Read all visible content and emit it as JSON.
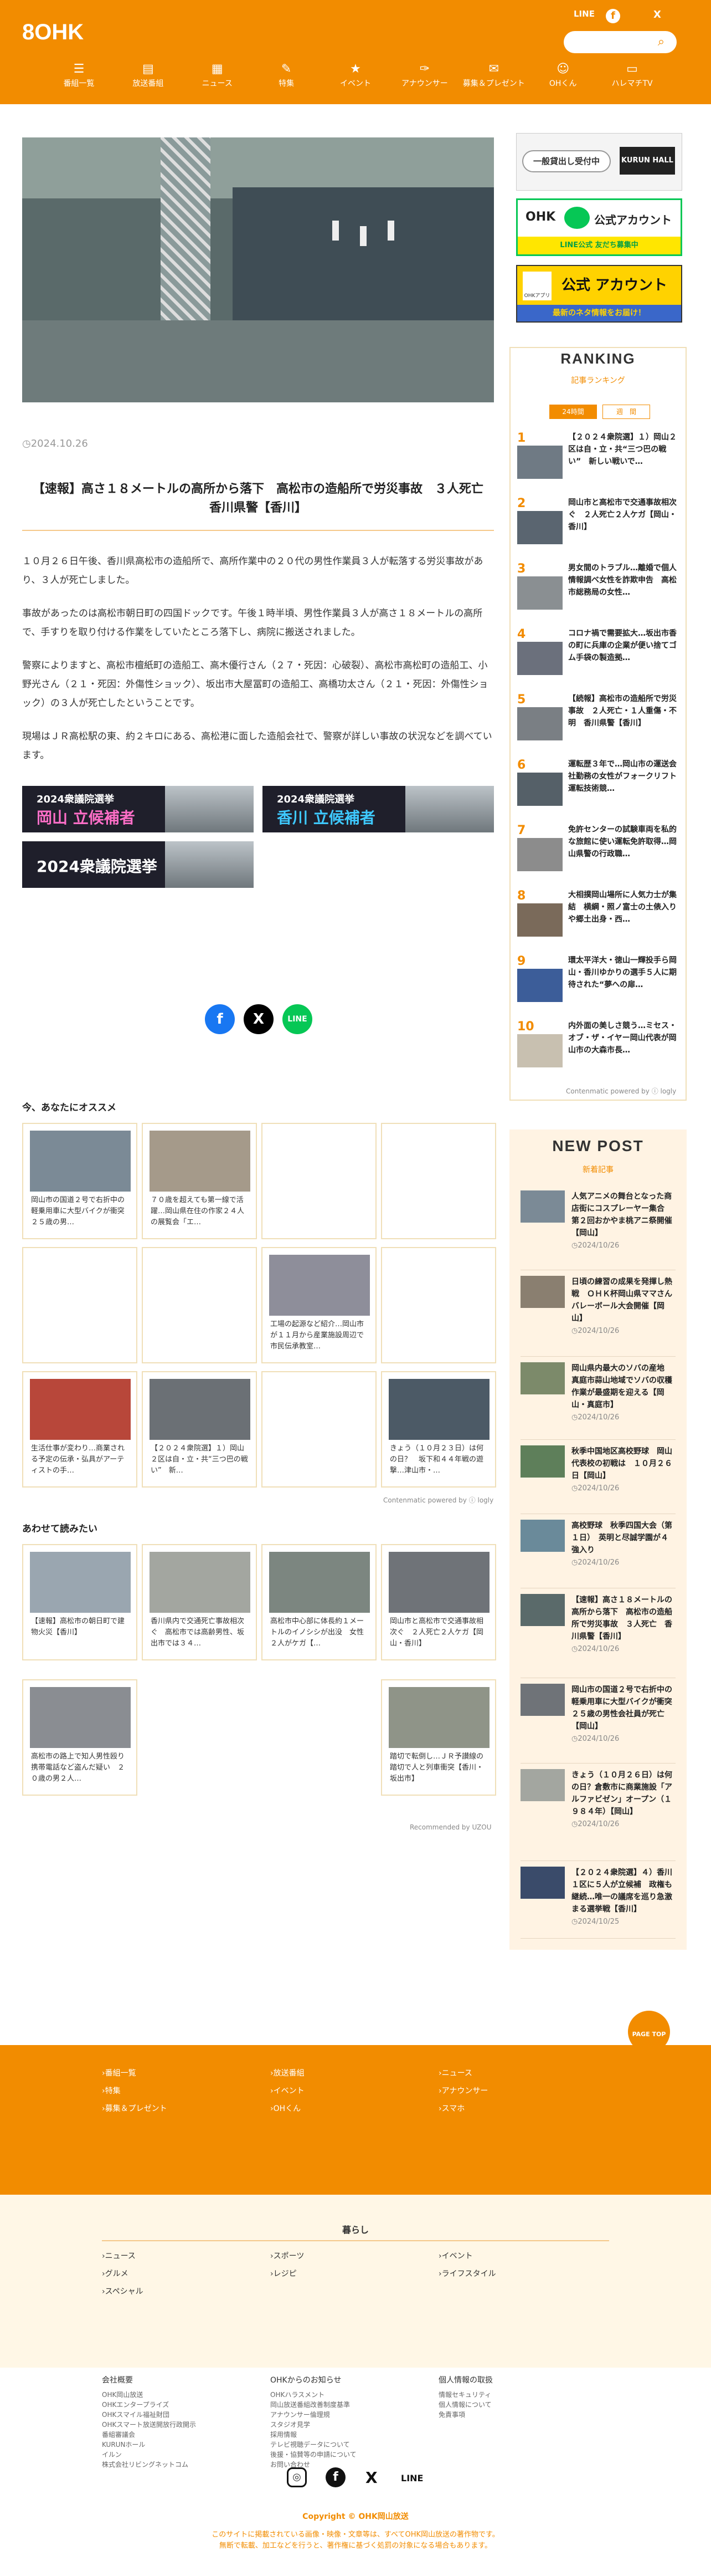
{
  "header": {
    "logo_num": "8",
    "logo_text": "OHK",
    "sns": [
      "LINE",
      "f",
      "X"
    ],
    "search_placeholder": "",
    "nav": [
      {
        "icon": "☰",
        "label": "番組一覧"
      },
      {
        "icon": "▤",
        "label": "放送番組"
      },
      {
        "icon": "▦",
        "label": "ニュース"
      },
      {
        "icon": "✎",
        "label": "特集"
      },
      {
        "icon": "★",
        "label": "イベント"
      },
      {
        "icon": "✑",
        "label": "アナウンサー"
      },
      {
        "icon": "✉",
        "label": "募集＆プレゼント"
      },
      {
        "icon": "☺",
        "label": "OHくん"
      },
      {
        "icon": "▭",
        "label": "ハレマチTV"
      }
    ]
  },
  "article": {
    "date": "2024.10.26",
    "title": "【速報】高さ１８メートルの高所から落下　高松市の造船所で労災事故　３人死亡　香川県警【香川】",
    "paragraphs": [
      "１０月２６日午後、香川県高松市の造船所で、高所作業中の２０代の男性作業員３人が転落する労災事故があり、３人が死亡しました。",
      "事故があったのは高松市朝日町の四国ドックです。午後１時半頃、男性作業員３人が高さ１８メートルの高所で、手すりを取り付ける作業をしていたところ落下し、病院に搬送されました。",
      "警察によりますと、高松市檀紙町の造船工、高木優行さん（２７・死因：心破裂）、高松市高松町の造船工、小野光さん（２１・死因：外傷性ショック）、坂出市大屋冨町の造船工、高橋功太さん（２１・死因：外傷性ショック）の３人が死亡したということです。",
      "現場はＪＲ高松駅の東、約２キロにある、高松港に面した造船会社で、警察が詳しい事故の状況などを調べています。"
    ],
    "banners": [
      {
        "year": "2024衆議院選挙",
        "name": "岡山 立候補者"
      },
      {
        "year": "2024衆議院選挙",
        "name": "香川 立候補者"
      },
      {
        "year": "",
        "name": "2024衆議院選挙"
      }
    ],
    "share": [
      "f",
      "X",
      "LINE"
    ]
  },
  "recommend": {
    "title": "今、あなたにオススメ",
    "cards": [
      "岡山市の国道２号で右折中の軽乗用車に大型バイクが衝突　２５歳の男…",
      "７０歳を超えても第一線で活躍…岡山県在住の作家２４人の展覧会「エ…",
      "",
      "",
      "",
      "",
      "工場の起源など紹介…岡山市が１１月から産業施設周辺で市民伝承教室…",
      "",
      "生活仕事が変わり…商業される予定の伝承・弘具がアーティストの手…",
      "【２０２４衆院選】１）岡山２区は自・立・共“三つ巴の戦い”　新…",
      "",
      "きょう（１０月２３日）は何の日？　坂下和４４年戦の遊撃…津山市・…"
    ],
    "powered": "Contenmatic powered by ⓘ logly"
  },
  "related": {
    "title": "あわせて読みたい",
    "cards": [
      "【速報】高松市の朝日町で建物火災【香川】",
      "香川県内で交通死亡事故相次ぐ　高松市では高齢男性、坂出市では３４…",
      "高松市中心部に体長約１メートルのイノシシが出没　女性２人がケガ【…",
      "岡山市と高松市で交通事故相次ぐ　２人死亡２人ケガ【岡山・香川】",
      "高松市の路上で知人男性殴り携帯電話など盗んだ疑い　２０歳の男２人…",
      "",
      "",
      "踏切で転倒し…ＪＲ予讃線の踏切で人と列車衝突【香川・坂出市】"
    ],
    "powered": "Recommended by UZOU"
  },
  "sidebar": {
    "ad1": "一般貸出し受付中",
    "ad1_brand": "KURUN HALL",
    "line_banner": {
      "brand": "OHK",
      "label": "公式アカウント",
      "sub": "LINE公式 友だち募集中"
    },
    "x_banner": {
      "brand": "OHKアプリ",
      "label": "公式 アカウント",
      "sub": "最新のネタ情報をお届け！"
    },
    "ranking": {
      "title": "RANKING",
      "subtitle": "記事ランキング",
      "tabs": [
        "24時間",
        "週　間"
      ],
      "items": [
        "【２０２４衆院選】１）岡山２区は自・立・共“三つ巴の戦い”　新しい戦いで…",
        "岡山市と高松市で交通事故相次ぐ　２人死亡２人ケガ【岡山・香川】",
        "男女間のトラブル…離婚で個人情報調べ女性を詐欺申告　高松市総務局の女性…",
        "コロナ禍で需要拡大…坂出市香の町に兵庫の企業が便い捨てゴム手袋の製造拠…",
        "【続報】高松市の造船所で労災事故　２人死亡・１人重傷・不明　香川県警【香川】",
        "運転歴３年で…岡山市の運送会社勤務の女性がフォークリフト運転技術競…",
        "免許センターの試験車両を私的な旅館に使い運転免許取得…岡山県警の行政職…",
        "大相撲岡山場所に人気力士が集結　横綱・照ノ富士の土俵入りや郷土出身・西…",
        "環太平洋大・徳山一輝投手ら岡山・香川ゆかりの選手５人に期待された“夢への扉…",
        "内外面の美しさ競う…ミセス・オブ・ザ・イヤー岡山代表が岡山市の大森市長…"
      ],
      "powered": "Contenmatic powered by ⓘ logly"
    },
    "newpost": {
      "title": "NEW POST",
      "subtitle": "新着記事",
      "items": [
        {
          "text": "人気アニメの舞台となった商店街にコスプレーヤー集合　第２回おかやま桃アニ祭開催【岡山】",
          "date": "2024/10/26"
        },
        {
          "text": "日頃の練習の成果を発揮し熱戦　ＯＨＫ杯岡山県ママさんバレーボール大会開催【岡山】",
          "date": "2024/10/26"
        },
        {
          "text": "岡山県内最大のソバの産地　真庭市蒜山地域でソバの収穫作業が最盛期を迎える【岡山・真庭市】",
          "date": "2024/10/26"
        },
        {
          "text": "秋季中国地区高校野球　岡山代表校の初戦は　１０月２６日【岡山】",
          "date": "2024/10/26"
        },
        {
          "text": "高校野球　秋季四国大会（第１日）　英明と尽誠学園が４強入り",
          "date": "2024/10/26"
        },
        {
          "text": "【速報】高さ１８メートルの高所から落下　高松市の造船所で労災事故　３人死亡　香川県警【香川】",
          "date": "2024/10/26"
        },
        {
          "text": "岡山市の国道２号で右折中の軽乗用車に大型バイクが衝突　２５歳の男性会社員が死亡【岡山】",
          "date": "2024/10/26"
        },
        {
          "text": "きょう（１０月２６日）は何の日？倉敷市に商業施設「アルファビゼン」オープン（１９８４年）【岡山】",
          "date": "2024/10/26"
        },
        {
          "text": "【２０２４衆院選】４）香川１区に５人が立候補　政権も継続…唯一の議席を巡り急激まる選挙戦【香川】",
          "date": "2024/10/25"
        }
      ]
    }
  },
  "page_top": "PAGE TOP",
  "footer": {
    "nav_cols": [
      [
        "番組一覧",
        "特集",
        "募集＆プレゼント"
      ],
      [
        "放送番組",
        "イベント",
        "OHくん"
      ],
      [
        "ニュース",
        "アナウンサー",
        "スマホ"
      ]
    ],
    "kurashi_title": "暮らし",
    "kurashi_cols": [
      [
        "ニュース",
        "グルメ",
        "スペシャル"
      ],
      [
        "スポーツ",
        "レジピ"
      ],
      [
        "イベント",
        "ライフスタイル"
      ]
    ],
    "about_title": "会社概要",
    "about_links": [
      "OHK岡山放送",
      "OHKエンタープライズ",
      "OHKスマイル福祉財団",
      "OHKスマート放送開放行政開示",
      "番組審議会",
      "KURUNホール",
      "イルン",
      "株式会社リビングネットコム"
    ],
    "notice_title": "OHKからのお知らせ",
    "notice_links": [
      "OHKハラスメント",
      "岡山放送番組改善制度基準",
      "アナウンサー倫理規",
      "スタジオ見学",
      "採用情報",
      "テレビ視聴データについて",
      "後援・協賛等の申請について",
      "お問い合わせ"
    ],
    "privacy_title": "個人情報の取扱",
    "privacy_links": [
      "情報セキュリティ",
      "個人情報について",
      "免責事項"
    ],
    "sns": [
      "◎",
      "f",
      "X",
      "LINE"
    ],
    "copyright": "Copyright © OHK岡山放送",
    "disclaimer1": "このサイトに掲載されている画像・映像・文章等は、すべてOHK岡山放送の著作物です。",
    "disclaimer2": "無断で転載、加工などを行うと、著作権に基づく処罰の対象になる場合もあります。"
  }
}
